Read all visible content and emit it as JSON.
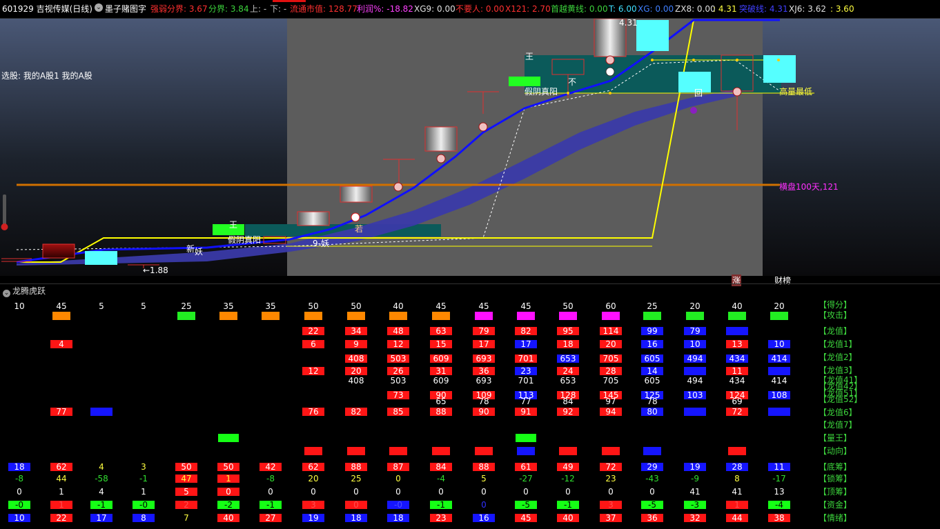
{
  "header": {
    "code_name": "601929 吉视传媒(日线)",
    "formula": "墨子赌图字",
    "items": [
      {
        "text": "强弱分界: 3.67",
        "color": "#ff3030"
      },
      {
        "text": "分界: 3.84",
        "color": "#3cd33c"
      },
      {
        "text": "上: -",
        "color": "#c0c0c0"
      },
      {
        "text": "下: -",
        "color": "#c0c0c0"
      },
      {
        "text": "流通市值: 128.77",
        "color": "#ff3030"
      },
      {
        "text": "利润%: -18.82",
        "color": "#ff40ff"
      },
      {
        "text": "XG9: 0.00",
        "color": "#e0e0e0"
      },
      {
        "text": "不要人: 0.00",
        "color": "#ff3030"
      },
      {
        "text": "X121: 2.70",
        "color": "#ff3030"
      },
      {
        "text": "首越黄线: 0.00",
        "color": "#3cd33c"
      },
      {
        "text": "T: 6.00",
        "color": "#40e0ff"
      },
      {
        "text": "XG: 0.00",
        "color": "#4080ff"
      },
      {
        "text": "ZX8: 0.00",
        "color": "#e0e0e0"
      },
      {
        "text": ": 4.31",
        "color": "#ffff40"
      },
      {
        "text": "突破线: 4.31",
        "color": "#4040ff"
      },
      {
        "text": "XJ6: 3.62",
        "color": "#e0e0e0"
      },
      {
        "text": ": 3.60",
        "color": "#ffff40"
      }
    ]
  },
  "main_chart": {
    "stock_select_text": "选股: 我的A股1 我的A股",
    "labels": {
      "high_price": "4.31",
      "low_price": "←1.88",
      "range_100": "横盘100天,121",
      "high_volume_low": "高量最低",
      "yin_yang_1": "假阴真阳",
      "yin_yang_2": "假阴真阳",
      "wang_1": "王",
      "wang_2": "王",
      "bu": "不",
      "hui": "回",
      "yao_1": "妖",
      "yao_2": "9-妖",
      "xin": "新",
      "zhang": "涨",
      "caibang": "财榜",
      "ruo": "若"
    }
  },
  "panel2": {
    "title": "龙腾虎跃",
    "header_values": [
      "10",
      "45",
      "5",
      "5",
      "25",
      "35",
      "35",
      "50",
      "50",
      "40",
      "45",
      "45",
      "45",
      "50",
      "60",
      "25",
      "20",
      "40",
      "20"
    ],
    "attack_colors": [
      "none",
      "#ff8800",
      "none",
      "none",
      "#22ee22",
      "#ff8800",
      "#ff8800",
      "#ff8800",
      "#ff8800",
      "#ff8800",
      "#ff8800",
      "#ff10ff",
      "#ff10ff",
      "#ff10ff",
      "#ff10ff",
      "#22ee22",
      "#22ee22",
      "#22ee22",
      "#22ee22"
    ],
    "row_labels": [
      "【得分】",
      "【攻击】",
      "【龙值】",
      "【龙值1】",
      "【龙值2】",
      "【龙值3】",
      "【龙值41】",
      "【龙值42】",
      "【龙值51】",
      "【龙值52】",
      "【龙值6】",
      "【龙值7】",
      "【量王】",
      "【动向】",
      "【底筹】",
      "【锁筹】",
      "【顶筹】",
      "【资金】",
      "【情绪】"
    ],
    "longzhi": [
      "",
      "",
      "",
      "",
      "",
      "",
      "",
      "22",
      "34",
      "48",
      "63",
      "79",
      "82",
      "95",
      "114",
      "99",
      "79",
      "",
      ""
    ],
    "longzhi_c": [
      "",
      "",
      "",
      "",
      "",
      "",
      "",
      "r",
      "r",
      "r",
      "r",
      "r",
      "r",
      "r",
      "r",
      "b",
      "b",
      "b",
      ""
    ],
    "longzhi1": [
      "",
      "4",
      "",
      "",
      "",
      "",
      "",
      "6",
      "9",
      "12",
      "15",
      "17",
      "17",
      "18",
      "20",
      "16",
      "10",
      "13",
      "10"
    ],
    "longzhi1_c": [
      "",
      "r",
      "",
      "",
      "",
      "",
      "",
      "r",
      "r",
      "r",
      "r",
      "r",
      "b",
      "r",
      "r",
      "b",
      "b",
      "r",
      "b"
    ],
    "longzhi2": [
      "",
      "",
      "",
      "",
      "",
      "",
      "",
      "",
      "408",
      "503",
      "609",
      "693",
      "701",
      "653",
      "705",
      "605",
      "494",
      "434",
      "414"
    ],
    "longzhi2_c": [
      "",
      "",
      "",
      "",
      "",
      "",
      "",
      "",
      "r",
      "r",
      "r",
      "r",
      "r",
      "b",
      "r",
      "b",
      "b",
      "b",
      "b"
    ],
    "longzhi3": [
      "",
      "",
      "",
      "",
      "",
      "",
      "",
      "12",
      "20",
      "26",
      "31",
      "36",
      "23",
      "24",
      "28",
      "14",
      "",
      "11",
      ""
    ],
    "longzhi3_c": [
      "",
      "",
      "",
      "",
      "",
      "",
      "",
      "r",
      "r",
      "r",
      "r",
      "r",
      "b",
      "r",
      "r",
      "b",
      "b",
      "r",
      "b"
    ],
    "longzhi41": [
      "",
      "",
      "",
      "",
      "",
      "",
      "",
      "",
      "408",
      "503",
      "609",
      "693",
      "701",
      "653",
      "705",
      "605",
      "494",
      "434",
      "414"
    ],
    "longzhi51": [
      "",
      "",
      "",
      "",
      "",
      "",
      "",
      "",
      "",
      "73",
      "90",
      "109",
      "113",
      "128",
      "145",
      "125",
      "103",
      "124",
      "108"
    ],
    "longzhi51_c": [
      "",
      "",
      "",
      "",
      "",
      "",
      "",
      "",
      "",
      "r",
      "r",
      "r",
      "b",
      "r",
      "r",
      "b",
      "b",
      "r",
      "b"
    ],
    "longzhi52": [
      "",
      "",
      "",
      "",
      "",
      "",
      "",
      "",
      "",
      "",
      "65",
      "78",
      "77",
      "84",
      "97",
      "78",
      "",
      "69",
      ""
    ],
    "longzhi6": [
      "",
      "77",
      "",
      "",
      "",
      "",
      "",
      "76",
      "82",
      "85",
      "88",
      "90",
      "91",
      "92",
      "94",
      "80",
      "",
      "72",
      ""
    ],
    "longzhi6_c": [
      "",
      "r",
      "b",
      "",
      "",
      "",
      "",
      "r",
      "r",
      "r",
      "r",
      "r",
      "r",
      "r",
      "r",
      "b",
      "b",
      "r",
      "b"
    ],
    "liangwang_c": [
      "",
      "",
      "",
      "",
      "",
      "g",
      "",
      "",
      "",
      "",
      "",
      "",
      "g",
      "",
      "",
      "",
      "",
      "",
      ""
    ],
    "dongxiang_c": [
      "",
      "",
      "",
      "",
      "",
      "",
      "",
      "r",
      "r",
      "r",
      "r",
      "r",
      "b",
      "r",
      "r",
      "b",
      "",
      "r",
      ""
    ],
    "dichou": [
      "18",
      "62",
      "4",
      "3",
      "50",
      "50",
      "42",
      "62",
      "88",
      "87",
      "84",
      "88",
      "61",
      "49",
      "72",
      "29",
      "19",
      "28",
      "11"
    ],
    "dichou_c": [
      "b",
      "r",
      "",
      "",
      "r",
      "r",
      "r",
      "r",
      "r",
      "r",
      "r",
      "r",
      "r",
      "r",
      "r",
      "b",
      "b",
      "b",
      "b"
    ],
    "suochou": [
      "-8",
      "44",
      "-58",
      "-1",
      "47",
      "1",
      "-8",
      "20",
      "25",
      "0",
      "-4",
      "5",
      "-27",
      "-12",
      "23",
      "-43",
      "-9",
      "8",
      "-17"
    ],
    "suochou_t": [
      "g",
      "y",
      "g",
      "g",
      "y",
      "w",
      "g",
      "y",
      "y",
      "y",
      "g",
      "y",
      "g",
      "g",
      "y",
      "g",
      "g",
      "y",
      "g"
    ],
    "suochou_box": [
      "",
      "",
      "",
      "",
      "r2",
      "r2",
      "",
      "",
      "",
      "",
      "",
      "",
      "",
      "",
      "",
      "",
      "",
      "",
      ""
    ],
    "dingchou": [
      "0",
      "1",
      "4",
      "1",
      "5",
      "0",
      "0",
      "0",
      "0",
      "0",
      "0",
      "0",
      "0",
      "0",
      "0",
      "0",
      "41",
      "41",
      "13"
    ],
    "dingchou_box": [
      "",
      "",
      "",
      "",
      "r",
      "r",
      "",
      "",
      "",
      "",
      "",
      "",
      "",
      "",
      "",
      "",
      "",
      "",
      ""
    ],
    "zijin": [
      "-0",
      "1",
      "-1",
      "-0",
      "2",
      "-2",
      "-1",
      "3",
      "0",
      "-0",
      "-1",
      "0",
      "-5",
      "-1",
      "3",
      "-5",
      "-3",
      "1",
      "-4"
    ],
    "zijin_c": [
      "g",
      "r",
      "g",
      "g",
      "r",
      "g",
      "g",
      "r",
      "r",
      "b",
      "g",
      "n",
      "g",
      "g",
      "r",
      "g",
      "g",
      "r",
      "g"
    ],
    "qingxu": [
      "10",
      "22",
      "17",
      "8",
      "7",
      "40",
      "27",
      "19",
      "18",
      "18",
      "23",
      "16",
      "45",
      "40",
      "37",
      "36",
      "32",
      "44",
      "38"
    ],
    "qingxu_c": [
      "b",
      "r",
      "b",
      "b",
      "",
      "r",
      "r",
      "b",
      "b",
      "b",
      "r",
      "b",
      "r",
      "r",
      "r",
      "r",
      "r",
      "r",
      "r"
    ]
  }
}
